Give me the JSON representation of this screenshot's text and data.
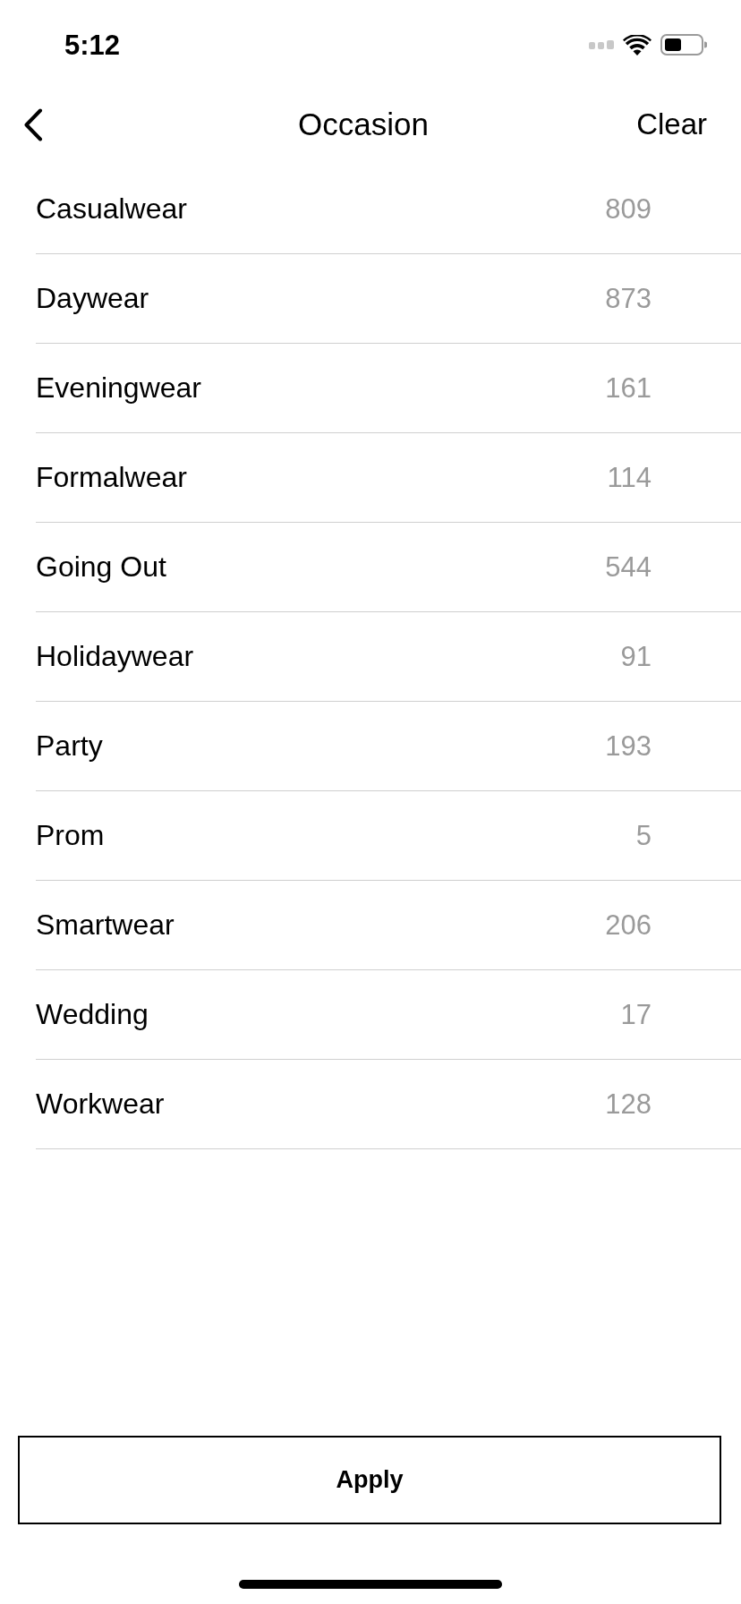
{
  "status_bar": {
    "time": "5:12"
  },
  "header": {
    "title": "Occasion",
    "clear": "Clear"
  },
  "occasions": [
    {
      "name": "Casualwear",
      "count": "809"
    },
    {
      "name": "Daywear",
      "count": "873"
    },
    {
      "name": "Eveningwear",
      "count": "161"
    },
    {
      "name": "Formalwear",
      "count": "114"
    },
    {
      "name": "Going Out",
      "count": "544"
    },
    {
      "name": "Holidaywear",
      "count": "91"
    },
    {
      "name": "Party",
      "count": "193"
    },
    {
      "name": "Prom",
      "count": "5"
    },
    {
      "name": "Smartwear",
      "count": "206"
    },
    {
      "name": "Wedding",
      "count": "17"
    },
    {
      "name": "Workwear",
      "count": "128"
    }
  ],
  "apply_button": "Apply"
}
